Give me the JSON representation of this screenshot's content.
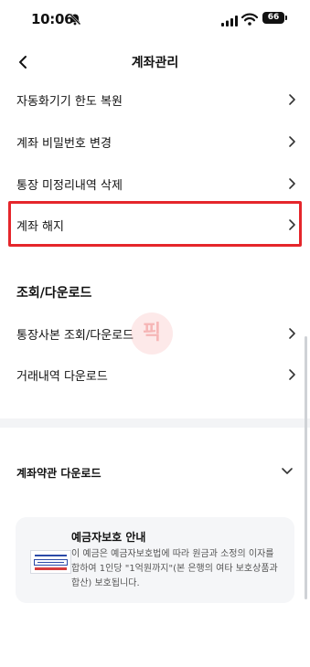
{
  "status_bar": {
    "time": "10:06",
    "battery": "66"
  },
  "header": {
    "title": "계좌관리"
  },
  "menu_items": [
    {
      "label": "자동화기기 한도 복원"
    },
    {
      "label": "계좌 비밀번호 변경"
    },
    {
      "label": "통장 미정리내역 삭제"
    },
    {
      "label": "계좌 해지"
    }
  ],
  "section": {
    "title": "조회/다운로드",
    "items": [
      {
        "label": "통장사본 조회/다운로드"
      },
      {
        "label": "거래내역 다운로드"
      }
    ]
  },
  "terms": {
    "title": "계좌약관 다운로드"
  },
  "protection_card": {
    "title": "예금자보호 안내",
    "body": "이 예금은 예금자보호법에 따라 원금과 소정의 이자를 합하여 1인당 \"1억원까지\"(본 은행의 여타 보호상품과 합산) 보호됩니다."
  },
  "watermark": "픽",
  "colors": {
    "highlight": "#e5262b",
    "logo_blue": "#2b4aa8",
    "logo_red": "#d63b3b"
  }
}
